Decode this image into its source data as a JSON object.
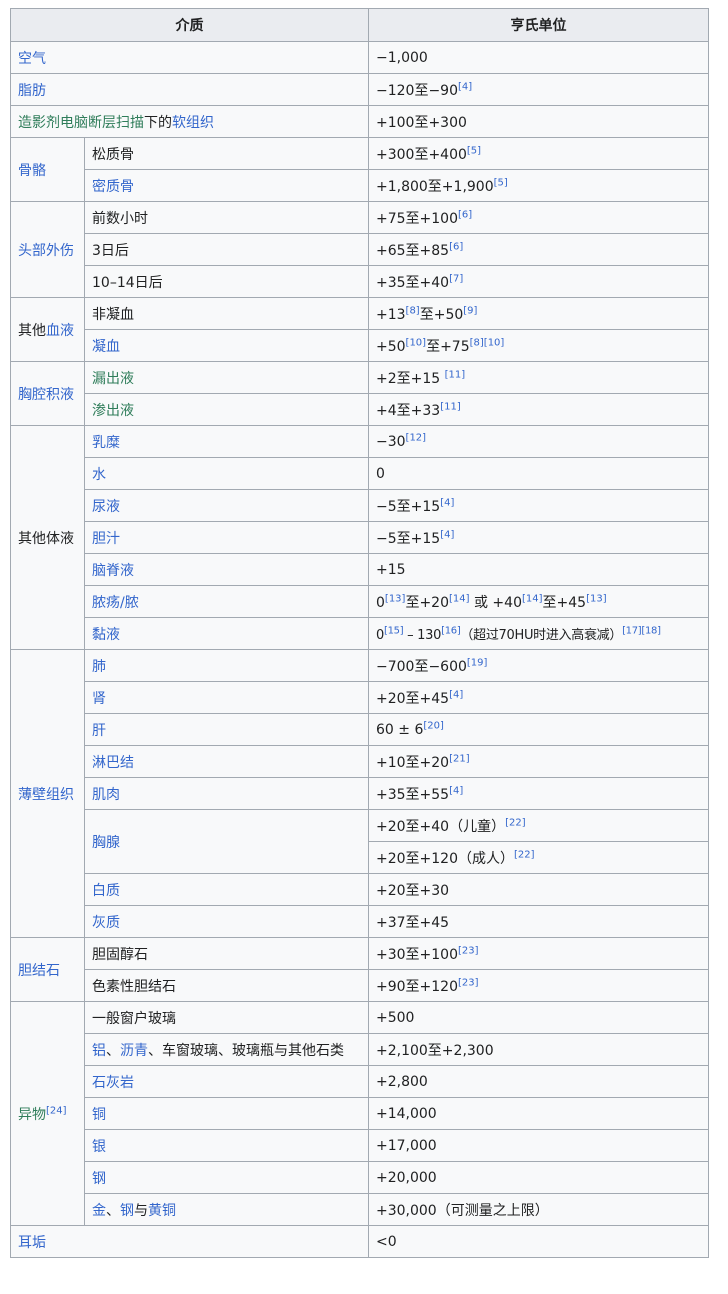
{
  "header": {
    "medium": "介质",
    "hu": "亨氏单位"
  },
  "rows": {
    "air": {
      "label": "空气",
      "value": "−1,000"
    },
    "fat": {
      "label": "脂肪",
      "value": "−120至−90",
      "ref": "[4]"
    },
    "soft": {
      "label_a": "造影剂电脑断层扫描",
      "label_b": "下的",
      "label_c": "软组织",
      "value": "+100至+300"
    },
    "bone": {
      "label": "骨骼",
      "cancellous": {
        "label": "松质骨",
        "value": "+300至+400",
        "ref": "[5]"
      },
      "cortical": {
        "label": "密质骨",
        "value": "+1,800至+1,900",
        "ref": "[5]"
      }
    },
    "head": {
      "label": "头部外伤",
      "hours": {
        "label": "前数小时",
        "value": "+75至+100",
        "ref": "[6]"
      },
      "day3": {
        "label": "3日后",
        "value": "+65至+85",
        "ref": "[6]"
      },
      "day10": {
        "label": "10–14日后",
        "value": "+35至+40",
        "ref": "[7]"
      }
    },
    "blood": {
      "label_a": "其他",
      "label_b": "血液",
      "unclotted": {
        "label": "非凝血",
        "v1": "+13",
        "r1": "[8]",
        "v2": "至+50",
        "r2": "[9]"
      },
      "clotted": {
        "label": "凝血",
        "v1": "+50",
        "r1": "[10]",
        "v2": "至+75",
        "r2": "[8][10]"
      }
    },
    "pleural": {
      "label": "胸腔积液",
      "transudate": {
        "label": "漏出液",
        "value": "+2至+15 ",
        "ref": "[11]"
      },
      "exudate": {
        "label": "渗出液",
        "value": "+4至+33",
        "ref": "[11]"
      }
    },
    "fluids": {
      "label": "其他体液",
      "chyle": {
        "label": "乳糜",
        "value": "−30",
        "ref": "[12]"
      },
      "water": {
        "label": "水",
        "value": "0"
      },
      "urine": {
        "label": "尿液",
        "value": "−5至+15",
        "ref": "[4]"
      },
      "bile": {
        "label": "胆汁",
        "value": "−5至+15",
        "ref": "[4]"
      },
      "csf": {
        "label": "脑脊液",
        "value": "+15"
      },
      "abscess": {
        "label": "脓疡/脓",
        "v1": "0",
        "r1": "[13]",
        "v2": "至+20",
        "r2": "[14]",
        "v3": " 或 +40",
        "r3": "[14]",
        "v4": "至+45",
        "r4": "[13]"
      },
      "mucus": {
        "label": "黏液",
        "v1": "0",
        "r1": "[15]",
        "v2": " – 130",
        "r2": "[16]",
        "v3": "（超过70HU时进入高衰减）",
        "r3": "[17][18]"
      }
    },
    "parenchyma": {
      "label": "薄壁组织",
      "lung": {
        "label": "肺",
        "value": "−700至−600",
        "ref": "[19]"
      },
      "kidney": {
        "label": "肾",
        "value": "+20至+45",
        "ref": "[4]"
      },
      "liver": {
        "label": "肝",
        "value": "60 ± 6",
        "ref": "[20]"
      },
      "lymph": {
        "label": "淋巴结",
        "value": "+10至+20",
        "ref": "[21]"
      },
      "muscle": {
        "label": "肌肉",
        "value": "+35至+55",
        "ref": "[4]"
      },
      "thymus": {
        "label": "胸腺",
        "value_child": "+20至+40（儿童）",
        "ref_child": "[22]",
        "value_adult": "+20至+120（成人）",
        "ref_adult": "[22]"
      },
      "white": {
        "label": "白质",
        "value": "+20至+30"
      },
      "grey": {
        "label": "灰质",
        "value": "+37至+45"
      }
    },
    "gallstone": {
      "label": "胆结石",
      "chol": {
        "label": "胆固醇石",
        "value": "+30至+100",
        "ref": "[23]"
      },
      "pigment": {
        "label": "色素性胆结石",
        "value": "+90至+120",
        "ref": "[23]"
      }
    },
    "foreign": {
      "label": "异物",
      "ref": "[24]",
      "glass": {
        "label": "一般窗户玻璃",
        "value": "+500"
      },
      "alum": {
        "l1": "铝",
        "l2": "、",
        "l3": "沥青",
        "l4": "、车窗玻璃、玻璃瓶与其他石类",
        "value": "+2,100至+2,300"
      },
      "limestone": {
        "label": "石灰岩",
        "value": "+2,800"
      },
      "copper": {
        "label": "铜",
        "value": "+14,000"
      },
      "silver": {
        "label": "银",
        "value": "+17,000"
      },
      "steel": {
        "label": "钢",
        "value": "+20,000"
      },
      "gold": {
        "l1": "金",
        "l2": "、",
        "l3": "钢",
        "l4": "与",
        "l5": "黄铜",
        "value": "+30,000（可测量之上限）"
      }
    },
    "earwax": {
      "label": "耳垢",
      "value": "<0"
    }
  }
}
